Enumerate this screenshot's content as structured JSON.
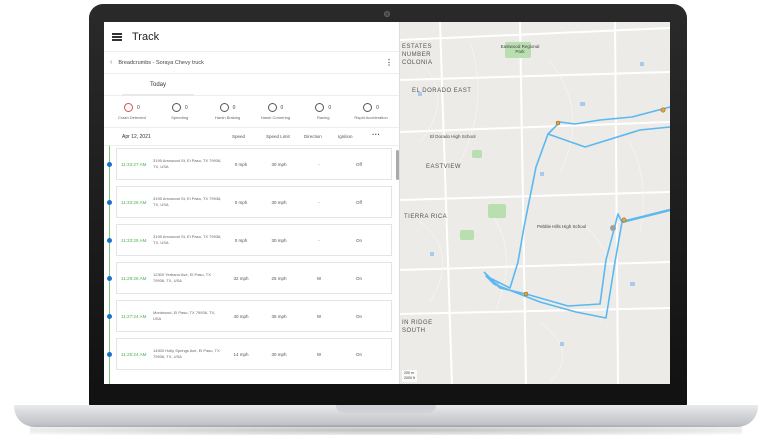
{
  "app": {
    "title": "Track"
  },
  "breadcrumb": {
    "text": "Breadcrumbs - Soraya Chevy truck"
  },
  "tabs": [
    {
      "label": "Today"
    }
  ],
  "events": [
    {
      "label": "Crash Detected",
      "count": "0",
      "icon": "crash-icon"
    },
    {
      "label": "Speeding",
      "count": "0",
      "icon": "speedometer-icon"
    },
    {
      "label": "Harsh Braking",
      "count": "0",
      "icon": "braking-icon"
    },
    {
      "label": "Harsh Cornering",
      "count": "0",
      "icon": "cornering-icon"
    },
    {
      "label": "Racing",
      "count": "0",
      "icon": "racing-icon"
    },
    {
      "label": "Rapid Acceleration",
      "count": "0",
      "icon": "acceleration-icon"
    }
  ],
  "table": {
    "date": "Apr 12, 2021",
    "headers": {
      "speed": "Speed",
      "limit": "Speed Limit",
      "direction": "Direction",
      "ignition": "Ignition"
    },
    "rows": [
      {
        "time": "11:33:27 AM",
        "address": "3195 Arrowood St, El Paso, TX 79936, TX, USA",
        "speed": "0 mph",
        "limit": "30 mph",
        "direction": "-",
        "ignition": "Off"
      },
      {
        "time": "11:33:26 AM",
        "address": "3195 Arrowood St, El Paso, TX 79936, TX, USA",
        "speed": "0 mph",
        "limit": "30 mph",
        "direction": "-",
        "ignition": "Off"
      },
      {
        "time": "11:33:25 AM",
        "address": "3195 Arrowood St, El Paso, TX 79936, TX, USA",
        "speed": "0 mph",
        "limit": "30 mph",
        "direction": "-",
        "ignition": "On"
      },
      {
        "time": "11:29:26 AM",
        "address": "12300 Yerbano Ave, El Paso, TX 79936, TX, USA",
        "speed": "32 mph",
        "limit": "25 mph",
        "direction": "W",
        "ignition": "On"
      },
      {
        "time": "11:27:24 AM",
        "address": "Montwood, El Paso, TX 79936, TX, USA",
        "speed": "40 mph",
        "limit": "35 mph",
        "direction": "W",
        "ignition": "On"
      },
      {
        "time": "11:25:24 AM",
        "address": "14300 Holly Springs Ave, El Paso, TX 79936, TX, USA",
        "speed": "14 mph",
        "limit": "30 mph",
        "direction": "W",
        "ignition": "On"
      }
    ]
  },
  "map": {
    "labels": {
      "estates": "ESTATES",
      "number": "NUMBER",
      "colonia": "COLONIA",
      "eastwood": "Eastwood Regional Park",
      "eldorado": "EL DORADO EAST",
      "eastview": "EASTVIEW",
      "tierra": "TIERRA RICA",
      "highschool": "El Dorado High School",
      "pebble": "Pebble Hills High School",
      "ridge": "IN RIDGE",
      "south": "SOUTH"
    },
    "scale": {
      "top": "200 m",
      "bottom": "2000 ft"
    },
    "route_color": "#5bb8f0",
    "park_color": "#b9dfb0"
  }
}
